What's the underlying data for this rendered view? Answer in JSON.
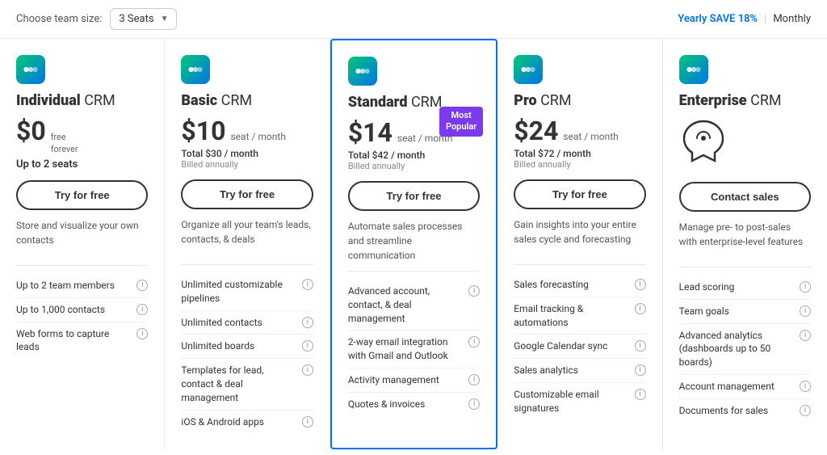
{
  "topBar": {
    "teamSizeLabel": "Choose team size:",
    "teamSizeValue": "3 Seats",
    "billingYearly": "Yearly SAVE 18%",
    "billingDivider": "|",
    "billingMonthly": "Monthly"
  },
  "plans": [
    {
      "id": "individual",
      "name": "Individual",
      "nameSuffix": "CRM",
      "price": "$0",
      "priceUnit": "",
      "freeSuffix": "free forever",
      "totalPrice": "",
      "billedNote": "",
      "seatsLabel": "Up to 2 seats",
      "btnLabel": "Try for free",
      "description": "Store and visualize your own contacts",
      "mostPopular": false,
      "isEnterprise": false,
      "features": [
        "Up to 2 team members",
        "Up to 1,000 contacts",
        "Web forms to capture leads"
      ]
    },
    {
      "id": "basic",
      "name": "Basic",
      "nameSuffix": "CRM",
      "price": "$10",
      "priceUnit": "seat / month",
      "freeSuffix": "",
      "totalPrice": "Total $30 / month",
      "billedNote": "Billed annually",
      "seatsLabel": "",
      "btnLabel": "Try for free",
      "description": "Organize all your team's leads, contacts, & deals",
      "mostPopular": false,
      "isEnterprise": false,
      "features": [
        "Unlimited customizable pipelines",
        "Unlimited contacts",
        "Unlimited boards",
        "Templates for lead, contact & deal management",
        "iOS & Android apps"
      ]
    },
    {
      "id": "standard",
      "name": "Standard",
      "nameSuffix": "CRM",
      "price": "$14",
      "priceUnit": "seat / month",
      "freeSuffix": "",
      "totalPrice": "Total $42 / month",
      "billedNote": "Billed annually",
      "seatsLabel": "",
      "btnLabel": "Try for free",
      "description": "Automate sales processes and streamline communication",
      "mostPopular": true,
      "isEnterprise": false,
      "features": [
        "Advanced account, contact, & deal management",
        "2-way email integration with Gmail and Outlook",
        "Activity management",
        "Quotes & invoices"
      ]
    },
    {
      "id": "pro",
      "name": "Pro",
      "nameSuffix": "CRM",
      "price": "$24",
      "priceUnit": "seat / month",
      "freeSuffix": "",
      "totalPrice": "Total $72 / month",
      "billedNote": "Billed annually",
      "seatsLabel": "",
      "btnLabel": "Try for free",
      "description": "Gain insights into your entire sales cycle and forecasting",
      "mostPopular": false,
      "isEnterprise": false,
      "features": [
        "Sales forecasting",
        "Email tracking & automations",
        "Google Calendar sync",
        "Sales analytics",
        "Customizable email signatures"
      ]
    },
    {
      "id": "enterprise",
      "name": "Enterprise",
      "nameSuffix": "CRM",
      "price": "",
      "priceUnit": "",
      "freeSuffix": "",
      "totalPrice": "",
      "billedNote": "",
      "seatsLabel": "",
      "btnLabel": "Contact sales",
      "description": "Manage pre- to post-sales with enterprise-level features",
      "mostPopular": false,
      "isEnterprise": true,
      "features": [
        "Lead scoring",
        "Team goals",
        "Advanced analytics (dashboards up to 50 boards)",
        "Account management",
        "Documents for sales"
      ]
    }
  ],
  "mostPopularLabel": "Most Popular"
}
